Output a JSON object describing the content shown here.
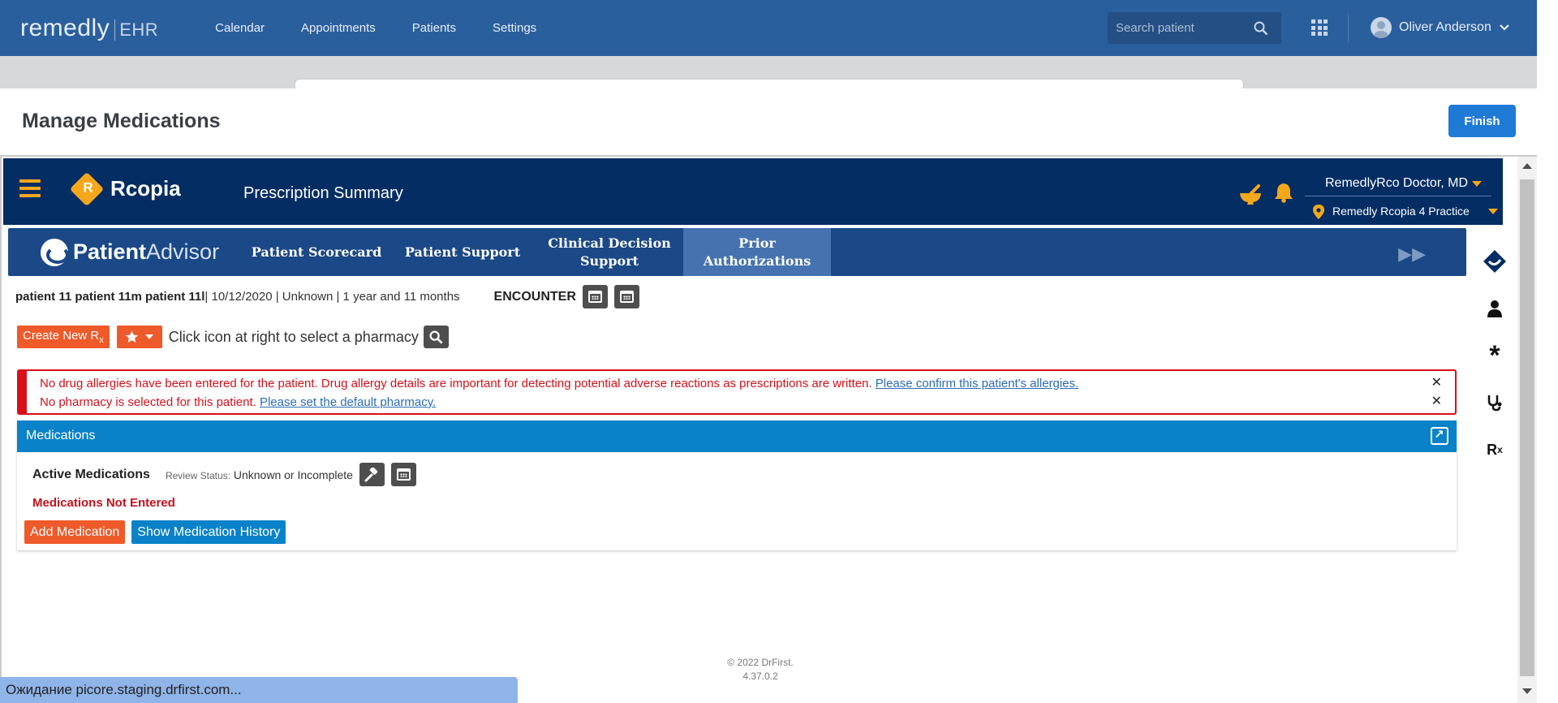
{
  "app": {
    "brand_main": "remedly",
    "brand_sub": "EHR",
    "nav": [
      "Calendar",
      "Appointments",
      "Patients",
      "Settings"
    ],
    "search_placeholder": "Search patient",
    "user_name": "Oliver Anderson"
  },
  "page": {
    "title": "Manage Medications",
    "finish_label": "Finish"
  },
  "rcopia": {
    "logo_text": "Rcopia",
    "title": "Prescription Summary",
    "doctor": "RemedlyRco Doctor, MD",
    "practice": "Remedly Rcopia 4 Practice",
    "pa_logo_bold": "Patient",
    "pa_logo_light": "Advisor",
    "tabs": [
      {
        "label_1": "Patient Scorecard",
        "label_2": ""
      },
      {
        "label_1": "Patient Support",
        "label_2": ""
      },
      {
        "label_1": "Clinical Decision",
        "label_2": "Support"
      },
      {
        "label_1": "Prior",
        "label_2": "Authorizations"
      }
    ],
    "active_tab": "Prior Authorizations"
  },
  "patient": {
    "name": "patient 11 patient 11m patient 11l",
    "details": " | 10/12/2020 | Unknown | 1 year and 11 months",
    "encounter_label": "ENCOUNTER"
  },
  "rx": {
    "create_label": "Create New R",
    "create_sub": "x",
    "pharmacy_prompt": "Click icon at right to select a pharmacy"
  },
  "alerts": [
    {
      "text": "No drug allergies have been entered for the patient. Drug allergy details are important for detecting potential adverse reactions as prescriptions are written. ",
      "link": "Please confirm this patient's allergies."
    },
    {
      "text": "No pharmacy is selected for this patient. ",
      "link": "Please set the default pharmacy."
    }
  ],
  "medications": {
    "header": "Medications",
    "active_label": "Active Medications",
    "review_label": "Review Status:",
    "review_value": " Unknown or Incomplete",
    "not_entered": "Medications Not Entered",
    "add_label": "Add Medication",
    "history_label": "Show Medication History"
  },
  "footer": {
    "copyright": "© 2022 DrFirst.",
    "version": "4.37.0.2"
  },
  "status_bar": "Ожидание picore.staging.drfirst.com...",
  "colors": {
    "ehr_bar": "#2a5f9e",
    "rcopia_navy": "#032d63",
    "accent_orange": "#ee5a2a",
    "accent_blue": "#0a82c9",
    "alert_red": "#d8101a",
    "rcopia_gold": "#f5a71c"
  }
}
